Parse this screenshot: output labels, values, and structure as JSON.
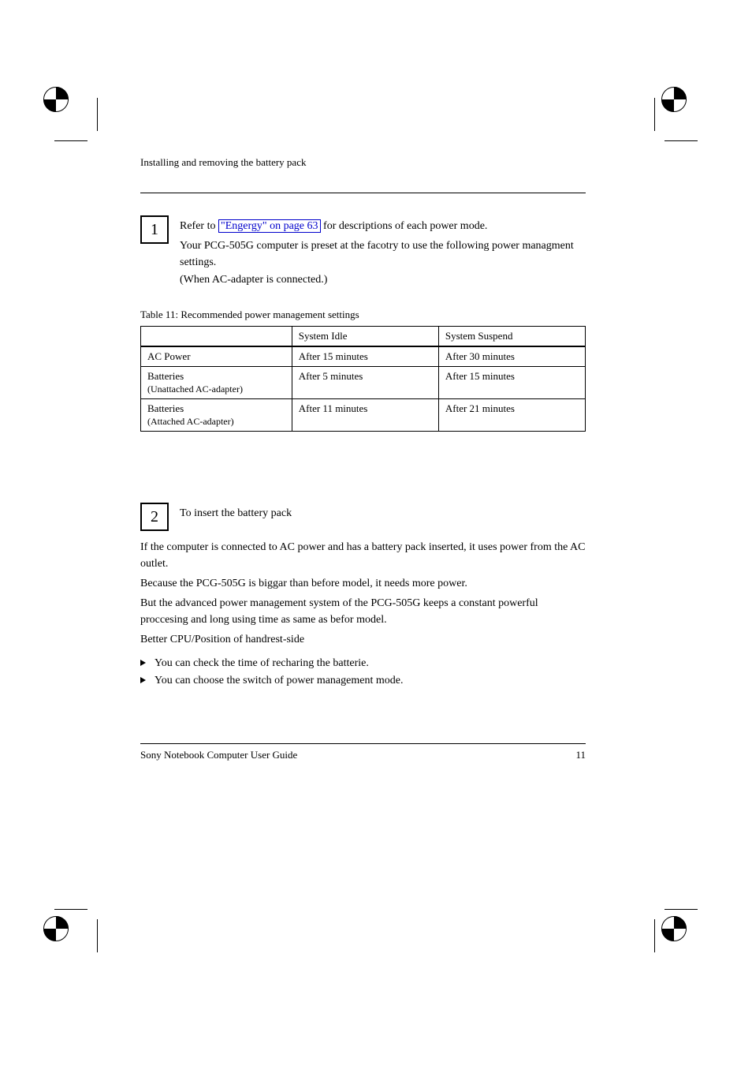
{
  "header": "Installing and removing the battery pack",
  "step1": {
    "num": "1",
    "lead_prefix": "Refer to ",
    "link_text": "\"Engergy\" on page 63",
    "lead_suffix": " for descriptions of each power mode.",
    "para": "Your PCG-505G computer is preset at the facotry to use the following power managment settings.",
    "subnote": "(When AC-adapter is connected.)"
  },
  "table": {
    "caption": "Table 11: Recommended power management settings",
    "headers": [
      "",
      "System Idle",
      "System Suspend"
    ],
    "rows": [
      [
        {
          "main": "AC Power"
        },
        {
          "main": "After 15 minutes"
        },
        {
          "main": "After 30 minutes"
        }
      ],
      [
        {
          "main": "Batteries",
          "sub": "(Unattached AC-adapter)"
        },
        {
          "main": "After 5 minutes"
        },
        {
          "main": "After 15 minutes"
        }
      ],
      [
        {
          "main": "Batteries",
          "sub": "(Attached AC-adapter)"
        },
        {
          "main": "After 11 minutes"
        },
        {
          "main": "After 21 minutes"
        }
      ]
    ]
  },
  "step2": {
    "num": "2",
    "lead": "To insert the battery pack",
    "para1": "If the computer is connected to AC power and has a battery pack inserted, it uses power from the AC outlet.",
    "para2": "Because the PCG-505G is biggar than before model, it needs more power.",
    "para3": "But the advanced power management system of the PCG-505G keeps a constant powerful proccesing and long using time as same as befor model.",
    "para4": "Better CPU/Position of handrest-side",
    "bulletTitle": "",
    "bullets": [
      "You can check the time of recharing the batterie.",
      "You can choose the switch of power management mode."
    ]
  },
  "footer": {
    "left": "Sony Notebook Computer User Guide",
    "right": "11"
  }
}
